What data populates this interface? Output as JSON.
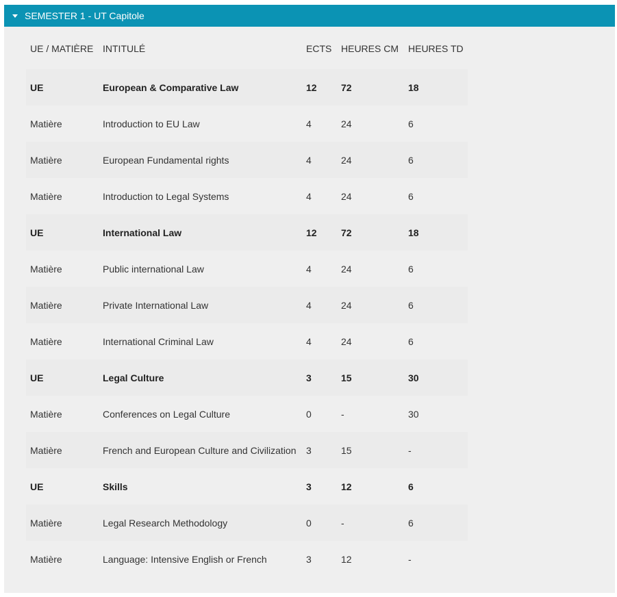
{
  "section": {
    "title": "SEMESTER 1 - UT Capitole"
  },
  "table": {
    "headers": {
      "type": "UE / MATIÈRE",
      "title": "INTITULÉ",
      "ects": "ECTS",
      "cm": "HEURES CM",
      "td": "HEURES TD"
    },
    "rows": [
      {
        "type": "UE",
        "title": "European & Comparative Law",
        "ects": "12",
        "cm": "72",
        "td": "18",
        "kind": "ue"
      },
      {
        "type": "Matière",
        "title": "Introduction to EU Law",
        "ects": "4",
        "cm": "24",
        "td": "6",
        "kind": "matiere"
      },
      {
        "type": "Matière",
        "title": "European Fundamental rights",
        "ects": "4",
        "cm": "24",
        "td": "6",
        "kind": "matiere"
      },
      {
        "type": "Matière",
        "title": "Introduction to Legal Systems",
        "ects": "4",
        "cm": "24",
        "td": "6",
        "kind": "matiere"
      },
      {
        "type": "UE",
        "title": "International Law",
        "ects": "12",
        "cm": "72",
        "td": "18",
        "kind": "ue"
      },
      {
        "type": "Matière",
        "title": "Public international Law",
        "ects": "4",
        "cm": "24",
        "td": "6",
        "kind": "matiere"
      },
      {
        "type": "Matière",
        "title": "Private International Law",
        "ects": "4",
        "cm": "24",
        "td": "6",
        "kind": "matiere"
      },
      {
        "type": "Matière",
        "title": "International Criminal Law",
        "ects": "4",
        "cm": "24",
        "td": "6",
        "kind": "matiere"
      },
      {
        "type": "UE",
        "title": "Legal Culture",
        "ects": "3",
        "cm": "15",
        "td": "30",
        "kind": "ue"
      },
      {
        "type": "Matière",
        "title": "Conferences on Legal Culture",
        "ects": "0",
        "cm": "-",
        "td": "30",
        "kind": "matiere"
      },
      {
        "type": "Matière",
        "title": "French and European Culture and Civilization",
        "ects": "3",
        "cm": "15",
        "td": "-",
        "kind": "matiere"
      },
      {
        "type": "UE",
        "title": "Skills",
        "ects": "3",
        "cm": "12",
        "td": "6",
        "kind": "ue"
      },
      {
        "type": "Matière",
        "title": "Legal Research Methodology",
        "ects": "0",
        "cm": "-",
        "td": "6",
        "kind": "matiere"
      },
      {
        "type": "Matière",
        "title": "Language: Intensive English or French",
        "ects": "3",
        "cm": "12",
        "td": "-",
        "kind": "matiere"
      }
    ]
  },
  "colors": {
    "header_bg": "#0b93b4",
    "panel_bg": "#efefef",
    "stripe_bg": "#ebebeb"
  }
}
